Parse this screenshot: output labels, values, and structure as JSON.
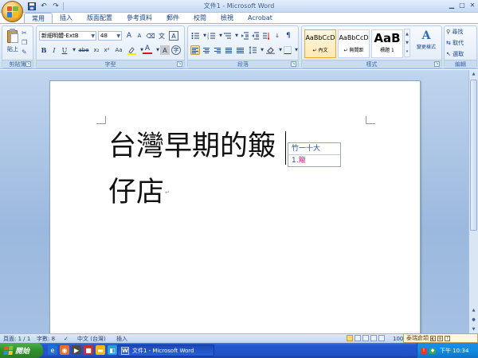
{
  "window": {
    "title": "文件1 - Microsoft Word",
    "controls": [
      "minimize-icon",
      "maximize-icon",
      "close-icon"
    ]
  },
  "quick_access": [
    "save-icon",
    "undo-icon",
    "redo-icon"
  ],
  "tabs": [
    {
      "label": "常用",
      "active": true
    },
    {
      "label": "插入"
    },
    {
      "label": "版面配置"
    },
    {
      "label": "參考資料"
    },
    {
      "label": "郵件"
    },
    {
      "label": "校閱"
    },
    {
      "label": "檢視"
    },
    {
      "label": "Acrobat"
    }
  ],
  "ribbon": {
    "clipboard": {
      "label": "剪貼簿",
      "paste_label": "貼上"
    },
    "font": {
      "label": "字型",
      "font_name": "新細明體-ExtB",
      "font_size": "48",
      "bold": "B",
      "italic": "I",
      "underline": "U",
      "strike": "abe",
      "subscript": "x₂",
      "superscript": "x²",
      "change_case": "Aa",
      "font_color": "A",
      "char_border": "A",
      "grow": "A",
      "shrink": "A",
      "phonetic": "文",
      "enclose": "字",
      "shading": "A"
    },
    "paragraph": {
      "label": "段落"
    },
    "styles": {
      "label": "樣式",
      "items": [
        {
          "sample": "AaBbCcD",
          "name": "↵ 內文",
          "selected": true
        },
        {
          "sample": "AaBbCcD",
          "name": "↵ 無間距",
          "selected": false
        },
        {
          "sample": "AaB",
          "name": "標題 1",
          "selected": false
        }
      ],
      "change_styles": "變更樣式"
    },
    "editing": {
      "label": "編輯",
      "find": "尋找",
      "replace": "取代",
      "select": "選取"
    }
  },
  "document": {
    "line1": "台灣早期的簸",
    "line2": "仔店",
    "ime": {
      "composition": "竹一十大",
      "candidate_num": "1.",
      "candidate_char": "簸"
    }
  },
  "status_bar": {
    "page": "頁面: 1 / 1",
    "words": "字數: 8",
    "language": "中文 (台灣)",
    "insert": "插入",
    "zoom": "100"
  },
  "language_bar": {
    "ime_name": "泰瑞倉頡"
  },
  "taskbar": {
    "start_label": "開始",
    "task_title": "文件1 - Microsoft Word",
    "clock": "下午 10:34"
  }
}
